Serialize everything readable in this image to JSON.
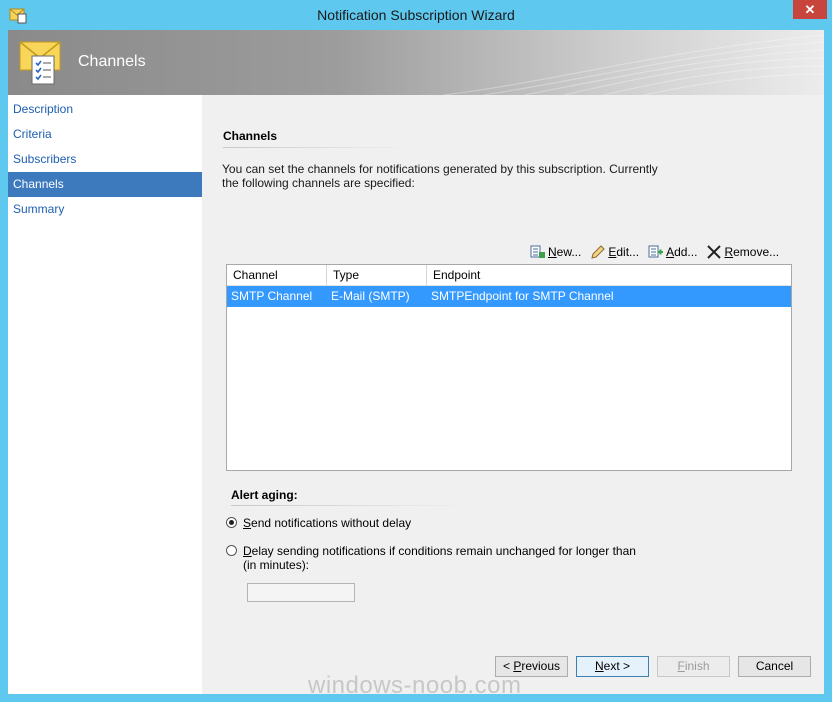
{
  "window": {
    "title": "Notification Subscription Wizard",
    "close_glyph": "✕"
  },
  "banner": {
    "heading": "Channels",
    "icon": "envelope-checklist-icon"
  },
  "nav": {
    "items": [
      {
        "label": "Description"
      },
      {
        "label": "Criteria"
      },
      {
        "label": "Subscribers"
      },
      {
        "label": "Channels",
        "active": true
      },
      {
        "label": "Summary"
      }
    ]
  },
  "channels": {
    "section_title": "Channels",
    "description": "You can set the channels for notifications generated by this subscription.  Currently the following channels are specified:",
    "toolbar": {
      "new_label_u": "N",
      "new_label_rest": "ew...",
      "edit_label_rest": "dit...",
      "edit_label_u": "E",
      "add_label_rest": "dd...",
      "add_label_u": "A",
      "remove_label_u": "R",
      "remove_label_rest": "emove..."
    },
    "table": {
      "columns": [
        "Channel",
        "Type",
        "Endpoint"
      ],
      "rows": [
        {
          "channel": "SMTP Channel",
          "type": "E-Mail (SMTP)",
          "endpoint": "SMTPEndpoint for SMTP Channel",
          "selected": true
        }
      ]
    }
  },
  "alert_aging": {
    "section_title": "Alert aging:",
    "option_send_u": "S",
    "option_send_rest": "end notifications without delay",
    "option_delay_u": "D",
    "option_delay_rest": "elay sending notifications if conditions remain unchanged for longer than (in minutes):",
    "selected": "send",
    "delay_value": ""
  },
  "footer": {
    "previous_lt": "< ",
    "previous_u": "P",
    "previous_rest": "revious",
    "next_u": "N",
    "next_rest": "ext >",
    "finish_u": "F",
    "finish_rest": "inish",
    "cancel_label": "Cancel"
  },
  "watermark": "windows-noob.com",
  "colors": {
    "frame": "#5ec8ef",
    "selection": "#3399ff",
    "nav_active": "#3d79bd",
    "link": "#1e5fb0"
  }
}
